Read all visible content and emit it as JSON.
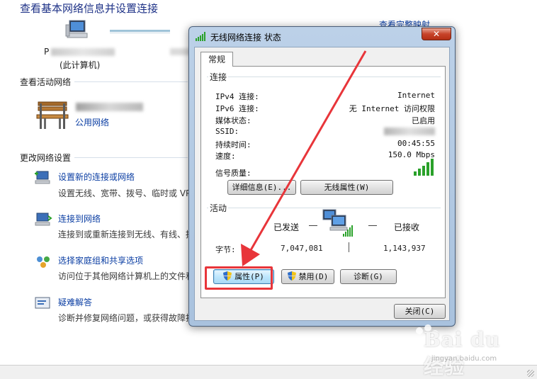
{
  "background": {
    "title": "查看基本网络信息并设置连接",
    "full_map_link": "查看完整映射",
    "computer_prefix": "P",
    "computer_sub": "(此计算机)",
    "active_networks_label": "查看活动网络",
    "public_network_link": "公用网络",
    "change_settings_label": "更改网络设置",
    "tasks": [
      {
        "link": "设置新的连接或网络",
        "desc": "设置无线、宽带、拨号、临时或 VP"
      },
      {
        "link": "连接到网络",
        "desc": "连接到或重新连接到无线、有线、拨"
      },
      {
        "link": "选择家庭组和共享选项",
        "desc": "访问位于其他网络计算机上的文件和"
      },
      {
        "link": "疑难解答",
        "desc": "诊断并修复网络问题，或获得故障排"
      }
    ]
  },
  "dialog": {
    "title": "无线网络连接 状态",
    "close_glyph": "✕",
    "tab": "常规",
    "connection_group": "连接",
    "rows": [
      {
        "label": "IPv4 连接:",
        "value": "Internet"
      },
      {
        "label": "IPv6 连接:",
        "value": "无 Internet 访问权限"
      },
      {
        "label": "媒体状态:",
        "value": "已启用"
      },
      {
        "label": "SSID:",
        "value": ""
      },
      {
        "label": "持续时间:",
        "value": "00:45:55"
      },
      {
        "label": "速度:",
        "value": "150.0 Mbps"
      }
    ],
    "signal_label": "信号质量:",
    "signal_level": 5,
    "details_button": "详细信息(E)...",
    "wireless_props_button": "无线属性(W)",
    "activity_group": "活动",
    "sent_label": "已发送",
    "received_label": "已接收",
    "bytes_label": "字节:",
    "bytes_sent": "7,047,081",
    "bytes_received": "1,143,937",
    "properties_button": "属性(P)",
    "disable_button": "禁用(D)",
    "diagnose_button": "诊断(G)",
    "close_button": "关闭(C)"
  },
  "watermark": {
    "main": "Bai du 经验",
    "sub": "jingyan.baidu.com"
  },
  "colors": {
    "link": "#0b3ea3",
    "title_blue": "#1e3287",
    "annotation_red": "#e8353a",
    "signal_green": "#2aa12a"
  }
}
